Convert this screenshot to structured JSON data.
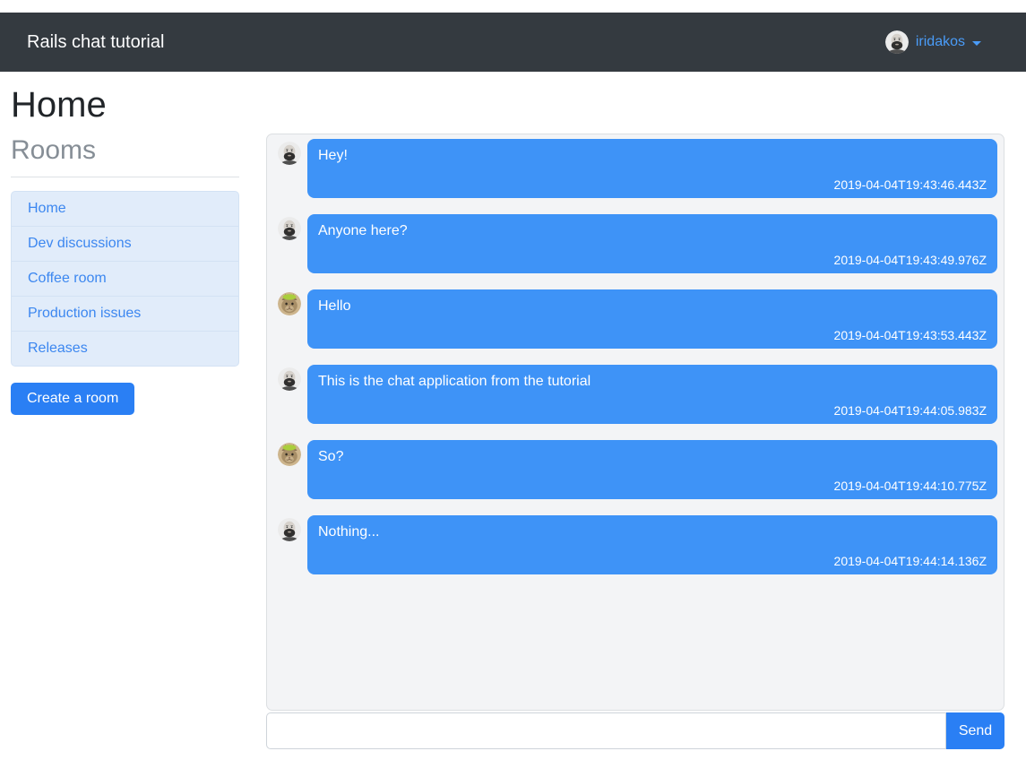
{
  "navbar": {
    "brand": "Rails chat tutorial",
    "user": {
      "name": "iridakos",
      "avatar": "bearded-man",
      "dropdown_icon": "chevron-down-icon"
    }
  },
  "page": {
    "title": "Home"
  },
  "sidebar": {
    "heading": "Rooms",
    "rooms": [
      {
        "label": "Home"
      },
      {
        "label": "Dev discussions"
      },
      {
        "label": "Coffee room"
      },
      {
        "label": "Production issues"
      },
      {
        "label": "Releases"
      }
    ],
    "create_button_label": "Create a room"
  },
  "chat": {
    "messages": [
      {
        "avatar": "bearded-man",
        "text": "Hey!",
        "timestamp": "2019-04-04T19:43:46.443Z"
      },
      {
        "avatar": "bearded-man",
        "text": "Anyone here?",
        "timestamp": "2019-04-04T19:43:49.976Z"
      },
      {
        "avatar": "cat-with-helmet",
        "text": "Hello",
        "timestamp": "2019-04-04T19:43:53.443Z"
      },
      {
        "avatar": "bearded-man",
        "text": "This is the chat application from the tutorial",
        "timestamp": "2019-04-04T19:44:05.983Z"
      },
      {
        "avatar": "cat-with-helmet",
        "text": "So?",
        "timestamp": "2019-04-04T19:44:10.775Z"
      },
      {
        "avatar": "bearded-man",
        "text": "Nothing...",
        "timestamp": "2019-04-04T19:44:14.136Z"
      }
    ],
    "input": {
      "value": "",
      "placeholder": ""
    },
    "send_button_label": "Send"
  },
  "colors": {
    "navbar_bg": "#343a40",
    "accent_blue": "#2a7ff4",
    "bubble_blue": "#3e93f7",
    "room_item_bg": "#e1ecfa",
    "room_link_blue": "#3c87f0",
    "user_link_blue": "#4a9cf8"
  }
}
